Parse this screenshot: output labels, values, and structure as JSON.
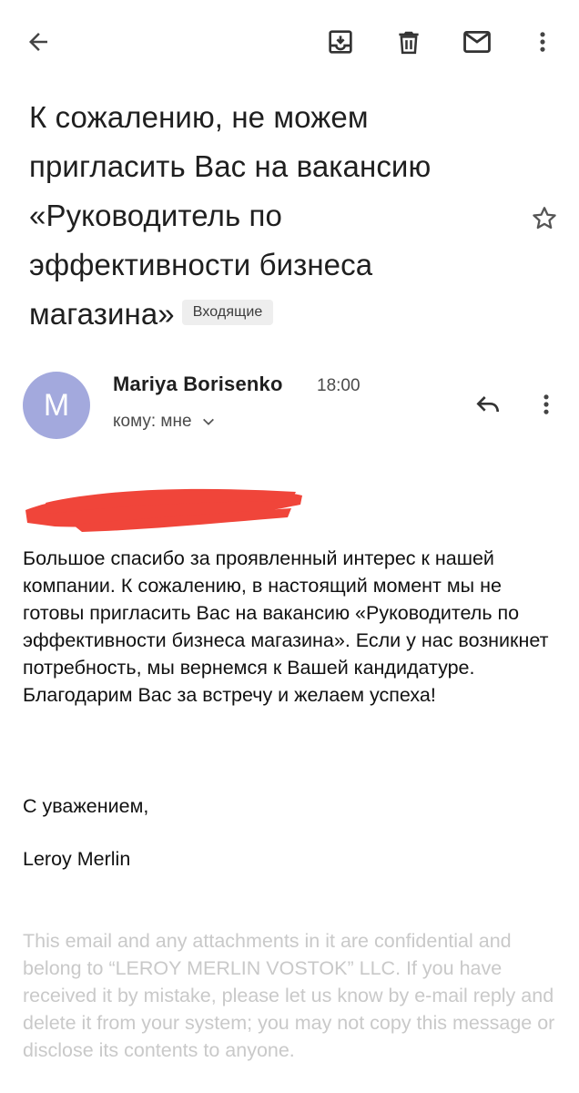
{
  "subject": {
    "text": "К сожалению, не можем пригласить Вас на вакансию «Руководитель по эффективности бизнеса магазина»",
    "label": "Входящие"
  },
  "sender": {
    "initial": "M",
    "name": "Mariya Borisenko",
    "time": "18:00",
    "recipient": "кому: мне"
  },
  "body": {
    "paragraph": "Большое спасибо за проявленный интерес к нашей компании. К сожалению, в настоящий момент мы не готовы пригласить Вас на вакансию «Руководитель по эффективности бизнеса магазина». Если у нас возникнет потребность, мы вернемся к Вашей кандидатуре.",
    "thanks": "Благодарим Вас за встречу и желаем успеха!",
    "closing": "С уважением,",
    "signature": "Leroy Merlin",
    "disclaimer": "This email and any attachments in it are confidential and belong to “LEROY MERLIN VOSTOK” LLC. If you have received it by mistake, please let us know by e-mail reply and delete it from your system; you may not copy this message or disclose its contents to anyone."
  },
  "icons": {
    "back": "arrow-back-icon",
    "archive": "archive-icon",
    "delete": "trash-icon",
    "unread": "mail-icon",
    "more": "more-vert-icon",
    "star": "star-outline-icon",
    "reply": "reply-icon",
    "expand": "chevron-down-icon"
  },
  "colors": {
    "avatar": "#a3a9dd",
    "redaction": "#f0453a",
    "disclaimer_text": "#c9c9c9",
    "label_chip": "#eeeeee"
  }
}
